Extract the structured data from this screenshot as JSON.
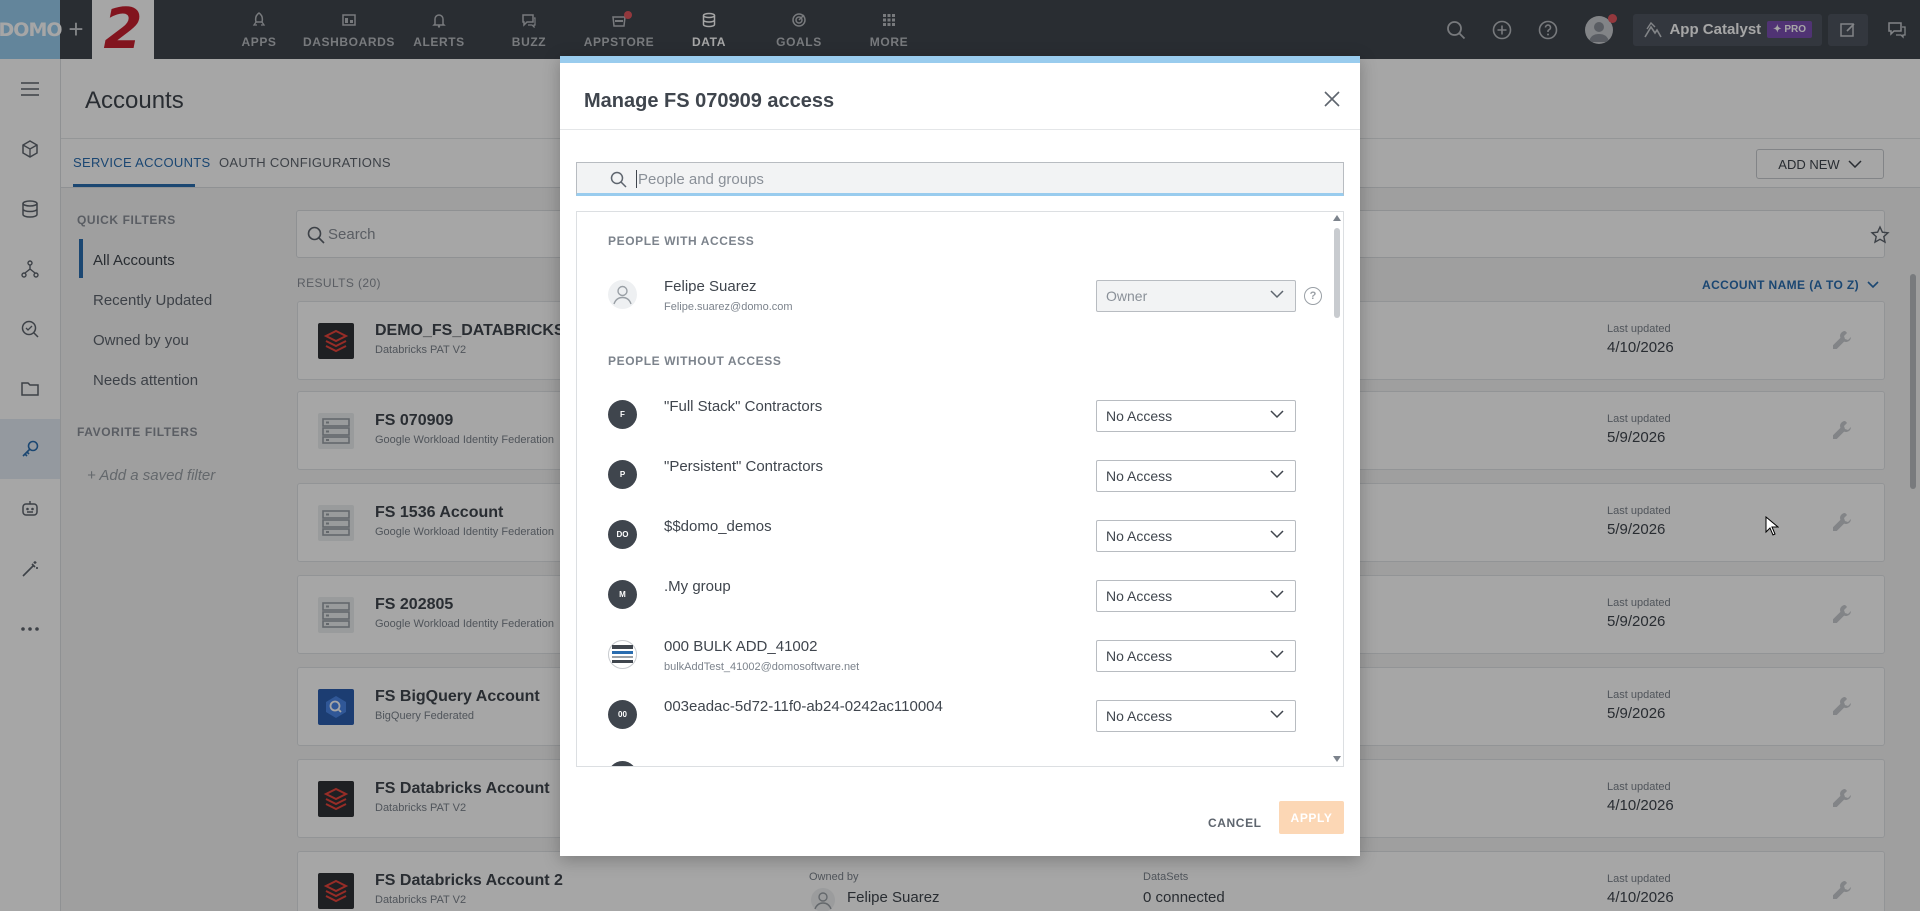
{
  "brand": {
    "logo_text": "DOMO",
    "plus": "+",
    "instance_badge": "2"
  },
  "nav": [
    {
      "label": "APPS",
      "icon": "rocket-icon"
    },
    {
      "label": "DASHBOARDS",
      "icon": "dashboard-icon"
    },
    {
      "label": "ALERTS",
      "icon": "bell-icon"
    },
    {
      "label": "BUZZ",
      "icon": "chat-icon"
    },
    {
      "label": "APPSTORE",
      "icon": "store-icon"
    },
    {
      "label": "DATA",
      "icon": "database-icon"
    },
    {
      "label": "GOALS",
      "icon": "target-icon"
    },
    {
      "label": "MORE",
      "icon": "grid-icon"
    }
  ],
  "topbar": {
    "app_catalyst": "App Catalyst",
    "pro_badge": "PRO"
  },
  "page": {
    "title": "Accounts",
    "tabs": [
      "SERVICE ACCOUNTS",
      "OAUTH CONFIGURATIONS"
    ],
    "add_new": "ADD NEW",
    "search_placeholder": "Search",
    "results": "RESULTS (20)",
    "sort": "ACCOUNT NAME (A TO Z)"
  },
  "filters": {
    "quick_heading": "QUICK FILTERS",
    "items": [
      "All Accounts",
      "Recently Updated",
      "Owned by you",
      "Needs attention"
    ],
    "favorite_heading": "FAVORITE FILTERS",
    "add_saved": "Add a saved filter"
  },
  "cards": [
    {
      "name": "DEMO_FS_DATABRICKS",
      "type": "Databricks PAT V2",
      "last_updated_label": "Last updated",
      "last_updated": "4/10/2026"
    },
    {
      "name": "FS 070909",
      "type": "Google Workload Identity Federation",
      "last_updated_label": "Last updated",
      "last_updated": "5/9/2026"
    },
    {
      "name": "FS 1536 Account",
      "type": "Google Workload Identity Federation",
      "last_updated_label": "Last updated",
      "last_updated": "5/9/2026"
    },
    {
      "name": "FS 202805",
      "type": "Google Workload Identity Federation",
      "last_updated_label": "Last updated",
      "last_updated": "5/9/2026"
    },
    {
      "name": "FS BigQuery Account",
      "type": "BigQuery Federated",
      "last_updated_label": "Last updated",
      "last_updated": "5/9/2026"
    },
    {
      "name": "FS Databricks Account",
      "type": "Databricks PAT V2",
      "last_updated_label": "Last updated",
      "last_updated": "4/10/2026"
    },
    {
      "name": "FS Databricks Account 2",
      "type": "Databricks PAT V2",
      "owned_label": "Owned by",
      "owner": "Felipe Suarez",
      "datasets_label": "DataSets",
      "datasets": "0 connected",
      "last_updated_label": "Last updated",
      "last_updated": "4/10/2026"
    }
  ],
  "modal": {
    "title": "Manage FS 070909 access",
    "search_placeholder": "People and groups",
    "with_access_heading": "PEOPLE WITH ACCESS",
    "without_access_heading": "PEOPLE WITHOUT ACCESS",
    "owner": {
      "name": "Felipe Suarez",
      "email": "Felipe.suarez@domo.com",
      "role": "Owner",
      "help": "?"
    },
    "people": [
      {
        "initials": "F",
        "name": "\"Full Stack\" Contractors",
        "email": "",
        "access": "No Access"
      },
      {
        "initials": "P",
        "name": "\"Persistent\" Contractors",
        "email": "",
        "access": "No Access"
      },
      {
        "initials": "DO",
        "name": "$$domo_demos",
        "email": "",
        "access": "No Access"
      },
      {
        "initials": "M",
        "name": ".My group",
        "email": "",
        "access": "No Access"
      },
      {
        "initials": "",
        "name": "000 BULK ADD_41002",
        "email": "bulkAddTest_41002@domosoftware.net",
        "access": "No Access"
      },
      {
        "initials": "00",
        "name": "003eadac-5d72-11f0-ab24-0242ac110004",
        "email": "",
        "access": "No Access"
      }
    ],
    "cancel": "CANCEL",
    "apply": "APPLY"
  },
  "colors": {
    "accent": "#2a6db0",
    "topbar": "#3f454d",
    "modal_stripe": "#99ccee",
    "apply_disabled": "#fcd7b5",
    "instance_red": "#c8202f"
  }
}
